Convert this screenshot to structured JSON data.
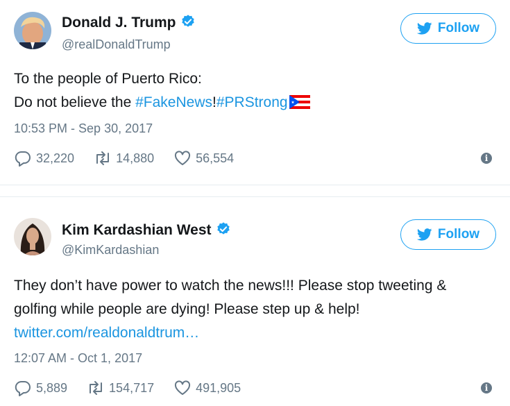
{
  "tweets": [
    {
      "name": "Donald J. Trump",
      "handle": "@realDonaldTrump",
      "follow_label": "Follow",
      "text_line1": "To the people of Puerto Rico:",
      "text_line2_prefix": "Do not believe the ",
      "hashtag1": "#FakeNews",
      "text_line2_mid": "!",
      "hashtag2": "#PRStrong",
      "timestamp": "10:53 PM - Sep 30, 2017",
      "replies": "32,220",
      "retweets": "14,880",
      "likes": "56,554"
    },
    {
      "name": "Kim Kardashian West",
      "handle": "@KimKardashian",
      "follow_label": "Follow",
      "text": "They don’t have power to watch the news!!! Please stop tweeting & golfing while people are dying! Please step up & help! ",
      "link": "twitter.com/realdonaldtrum…",
      "timestamp": "12:07 AM - Oct 1, 2017",
      "replies": "5,889",
      "retweets": "154,717",
      "likes": "491,905"
    }
  ],
  "icons": {
    "verified": "verified-badge-icon",
    "bird": "twitter-bird-icon",
    "reply": "reply-icon",
    "retweet": "retweet-icon",
    "like": "heart-icon",
    "more": "info-icon",
    "flag": "puerto-rico-flag-icon"
  },
  "colors": {
    "accent": "#1da1f2",
    "link": "#1b95e0",
    "muted": "#657786",
    "text": "#14171a"
  }
}
